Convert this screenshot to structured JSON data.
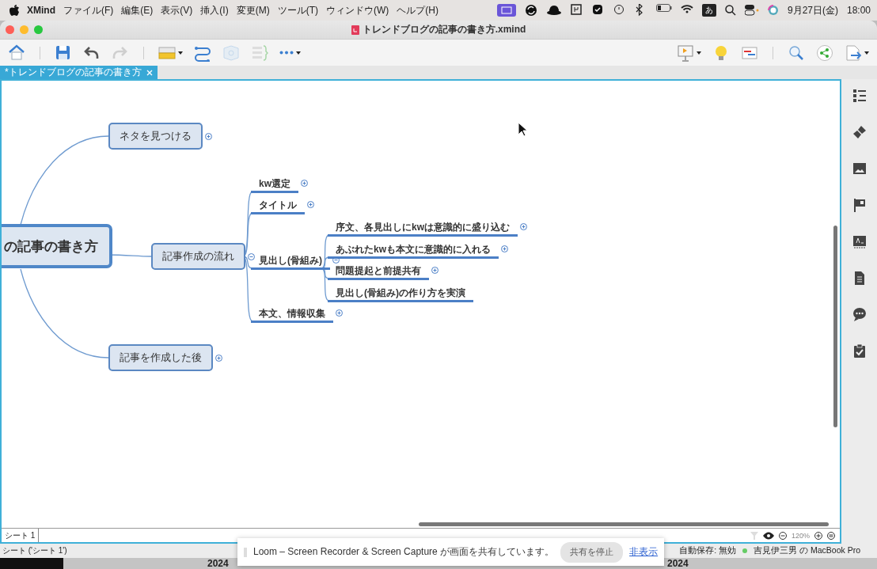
{
  "menubar": {
    "app": "XMind",
    "menus": [
      "ファイル(F)",
      "編集(E)",
      "表示(V)",
      "挿入(I)",
      "変更(M)",
      "ツール(T)",
      "ウィンドウ(W)",
      "ヘルプ(H)"
    ],
    "input_source": "あ",
    "date": "9月27日(金)",
    "time": "18:00"
  },
  "window": {
    "title": "トレンドブログの記事の書き方.xmind"
  },
  "toolbar": {
    "left": [
      {
        "disabled": false
      },
      {
        "disabled": false
      },
      {
        "disabled": false
      },
      {
        "disabled": true
      },
      {
        "disabled": false
      },
      {
        "disabled": false
      },
      {
        "disabled": true
      },
      {
        "disabled": true
      },
      {
        "disabled": false
      }
    ],
    "right": [
      {
        "disabled": false
      },
      {
        "disabled": false
      },
      {
        "disabled": false
      },
      {
        "disabled": false
      },
      {
        "disabled": false
      },
      {
        "disabled": false
      }
    ]
  },
  "tabs": [
    {
      "label": "*トレンドブログの記事の書き方",
      "selected": true
    }
  ],
  "mindmap": {
    "central": {
      "label": "の記事の書き方"
    },
    "topics": [
      {
        "label": "ネタを見つける",
        "collapsed": true
      },
      {
        "label": "記事作成の流れ",
        "collapsed": false,
        "children": [
          {
            "label": "kw選定",
            "collapsed": true
          },
          {
            "label": "タイトル",
            "collapsed": true
          },
          {
            "label": "見出し(骨組み)",
            "collapsed": false,
            "children": [
              {
                "label": "序文、各見出しにkwは意識的に盛り込む",
                "collapsed": true
              },
              {
                "label": "あぶれたkwも本文に意識的に入れる",
                "collapsed": true
              },
              {
                "label": "問題提起と前提共有",
                "collapsed": true
              },
              {
                "label": "見出し(骨組み)の作り方を実演",
                "collapsed": false
              }
            ]
          },
          {
            "label": "本文、情報収集",
            "collapsed": true
          }
        ]
      },
      {
        "label": "記事を作成した後",
        "collapsed": true
      }
    ]
  },
  "sheet_tabs": [
    {
      "label": "シート 1",
      "selected": true
    }
  ],
  "zoom": "120%",
  "status_bar": {
    "sheet": "シート ('シート 1')",
    "autosave": "自動保存: 無効",
    "device": "吉見伊三男 の MacBook Pro"
  },
  "notification": {
    "message": "Loom – Screen Recorder & Screen Capture が画面を共有しています。",
    "button": "共有を停止",
    "link": "非表示"
  },
  "desktop": {
    "labels": [
      "2024",
      "2024"
    ]
  }
}
